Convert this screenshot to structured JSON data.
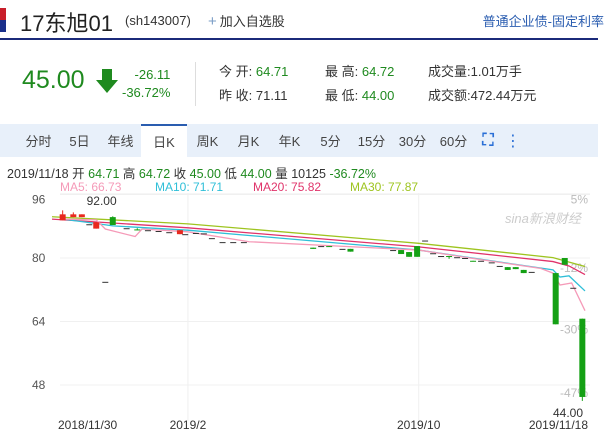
{
  "header": {
    "name": "17东旭01",
    "code": "(sh143007)",
    "add_favorite": "加入自选股",
    "bond_type": "普通企业债-固定利率"
  },
  "quote": {
    "price": "45.00",
    "change": "-26.11",
    "change_pct": "-36.72%",
    "direction_icon": "arrow-down-icon",
    "open_label": "今 开:",
    "open": "64.71",
    "prev_close_label": "昨 收:",
    "prev_close": "71.11",
    "high_label": "最 高:",
    "high": "64.72",
    "low_label": "最 低:",
    "low": "44.00",
    "volume_label": "成交量:",
    "volume": "1.01万手",
    "amount_label": "成交额:",
    "amount": "472.44万元"
  },
  "tabs": [
    "分时",
    "5日",
    "年线",
    "日K",
    "周K",
    "月K",
    "年K",
    "5分",
    "15分",
    "30分",
    "60分"
  ],
  "active_tab": "日K",
  "info": {
    "date": "2019/11/18",
    "open_l": "开",
    "open": "64.71",
    "high_l": "高",
    "high": "64.72",
    "close_l": "收",
    "close": "45.00",
    "low_l": "低",
    "low": "44.00",
    "vol_l": "量",
    "vol": "10125",
    "pct": "-36.72%"
  },
  "ma_legend": {
    "ma5": "MA5: 66.73",
    "ma10": "MA10: 71.71",
    "ma20": "MA20: 75.82",
    "ma30": "MA30: 77.87"
  },
  "colors": {
    "up": "#e8281e",
    "down": "#14a014",
    "ma5": "#f59ab8",
    "ma10": "#2fbfd8",
    "ma20": "#e0336a",
    "ma30": "#9ec41f",
    "accent": "#2a5db0"
  },
  "chart_data": {
    "type": "candlestick",
    "watermark": "sina新浪财经",
    "x_range": [
      0,
      100
    ],
    "ylim": [
      42,
      98
    ],
    "y_ticks": [
      96,
      80,
      64,
      48
    ],
    "right_ticks": [
      {
        "label": "5%",
        "value": 96
      },
      {
        "label": "-12%",
        "value": 77.5
      },
      {
        "label": "-30%",
        "value": 62
      },
      {
        "label": "-47%",
        "value": 46
      }
    ],
    "x_ticks": [
      {
        "label": "2018/11/30",
        "x": 2
      },
      {
        "label": "2019/2",
        "x": 25.5
      },
      {
        "label": "2019/10",
        "x": 68.8
      },
      {
        "label": "2019/11/18",
        "x": 99.5
      }
    ],
    "max_label": {
      "text": "92.00",
      "x": 8,
      "value": 92
    },
    "min_label": {
      "text": "44.00",
      "x": 99.5,
      "value": 44
    },
    "candles": [
      {
        "x": 2,
        "o": 89.5,
        "c": 91,
        "h": 92,
        "l": 89.5
      },
      {
        "x": 4,
        "o": 90.3,
        "c": 91,
        "h": 91.5,
        "l": 90.3
      },
      {
        "x": 5.6,
        "o": 90.3,
        "c": 91,
        "h": 91,
        "l": 90.3
      },
      {
        "x": 7,
        "o": 88.5,
        "c": 88.5,
        "h": 88.5,
        "l": 88.5
      },
      {
        "x": 8.3,
        "o": 87.4,
        "c": 89,
        "h": 89,
        "l": 87.4
      },
      {
        "x": 10,
        "o": 74,
        "c": 74,
        "h": 74,
        "l": 74
      },
      {
        "x": 11.4,
        "o": 90.3,
        "c": 88.3,
        "h": 90.5,
        "l": 88.3
      },
      {
        "x": 14,
        "o": 87.5,
        "c": 87.5,
        "h": 87.5,
        "l": 87.5
      },
      {
        "x": 16,
        "o": 87.2,
        "c": 87.1,
        "h": 87.5,
        "l": 87
      },
      {
        "x": 18,
        "o": 87,
        "c": 87,
        "h": 87,
        "l": 87
      },
      {
        "x": 20,
        "o": 86.8,
        "c": 86.8,
        "h": 86.8,
        "l": 86.8
      },
      {
        "x": 22,
        "o": 86.5,
        "c": 86.5,
        "h": 86.5,
        "l": 86.5
      },
      {
        "x": 24,
        "o": 86,
        "c": 87,
        "h": 87,
        "l": 86
      },
      {
        "x": 25,
        "o": 86,
        "c": 86,
        "h": 86,
        "l": 86
      },
      {
        "x": 27,
        "o": 86.3,
        "c": 86.3,
        "h": 86.3,
        "l": 86.3
      },
      {
        "x": 28.5,
        "o": 86.2,
        "c": 86.2,
        "h": 86.2,
        "l": 86.2
      },
      {
        "x": 30,
        "o": 85,
        "c": 85,
        "h": 85,
        "l": 85
      },
      {
        "x": 32,
        "o": 84,
        "c": 84,
        "h": 84,
        "l": 84
      },
      {
        "x": 34,
        "o": 84,
        "c": 84,
        "h": 84,
        "l": 84
      },
      {
        "x": 36,
        "o": 84,
        "c": 84,
        "h": 84,
        "l": 84
      },
      {
        "x": 49,
        "o": 82.6,
        "c": 82.3,
        "h": 82.6,
        "l": 82.3
      },
      {
        "x": 50.5,
        "o": 83,
        "c": 83,
        "h": 83,
        "l": 83
      },
      {
        "x": 52,
        "o": 83,
        "c": 82.8,
        "h": 83,
        "l": 82.8
      },
      {
        "x": 54.5,
        "o": 82.3,
        "c": 82.3,
        "h": 82.3,
        "l": 82.3
      },
      {
        "x": 56,
        "o": 82.3,
        "c": 81.6,
        "h": 82.3,
        "l": 81.6
      },
      {
        "x": 64,
        "o": 82,
        "c": 82,
        "h": 82,
        "l": 82
      },
      {
        "x": 65.5,
        "o": 82,
        "c": 81,
        "h": 82,
        "l": 81
      },
      {
        "x": 67,
        "o": 81.5,
        "c": 80.3,
        "h": 81.5,
        "l": 80.3
      },
      {
        "x": 68.5,
        "o": 83,
        "c": 80.3,
        "h": 83,
        "l": 80.3
      },
      {
        "x": 70,
        "o": 84.4,
        "c": 84.4,
        "h": 84.4,
        "l": 84.4
      },
      {
        "x": 71.5,
        "o": 81.2,
        "c": 81.2,
        "h": 81.2,
        "l": 81.2
      },
      {
        "x": 73,
        "o": 80.5,
        "c": 80.5,
        "h": 80.5,
        "l": 80.5
      },
      {
        "x": 74.5,
        "o": 80.5,
        "c": 80.3,
        "h": 80.5,
        "l": 79.8
      },
      {
        "x": 76,
        "o": 80.2,
        "c": 80.2,
        "h": 80.2,
        "l": 80.2
      },
      {
        "x": 77.5,
        "o": 80,
        "c": 80,
        "h": 80,
        "l": 80
      },
      {
        "x": 79,
        "o": 79.3,
        "c": 79.1,
        "h": 79.3,
        "l": 79.1
      },
      {
        "x": 80.5,
        "o": 79.3,
        "c": 79.3,
        "h": 79.3,
        "l": 79.3
      },
      {
        "x": 82.5,
        "o": 78.9,
        "c": 78.9,
        "h": 78.9,
        "l": 78.9
      },
      {
        "x": 84,
        "o": 78,
        "c": 78,
        "h": 78,
        "l": 78
      },
      {
        "x": 85.5,
        "o": 77.7,
        "c": 77,
        "h": 77.7,
        "l": 77
      },
      {
        "x": 87,
        "o": 77.7,
        "c": 77.2,
        "h": 77.7,
        "l": 77.2
      },
      {
        "x": 88.5,
        "o": 77,
        "c": 76.2,
        "h": 77,
        "l": 76.2
      },
      {
        "x": 90,
        "o": 76.5,
        "c": 76.5,
        "h": 76.5,
        "l": 76.5
      },
      {
        "x": 94.5,
        "o": 76.2,
        "c": 63.3,
        "h": 76.2,
        "l": 63.3
      },
      {
        "x": 96.2,
        "o": 80,
        "c": 78.3,
        "h": 80,
        "l": 78.3
      },
      {
        "x": 97.8,
        "o": 72.5,
        "c": 72.5,
        "h": 72.5,
        "l": 72.5
      },
      {
        "x": 99.5,
        "o": 64.71,
        "c": 45,
        "h": 64.72,
        "l": 44
      }
    ],
    "series": [
      {
        "name": "MA30",
        "x": [
          0,
          25.5,
          68.8,
          94,
          100
        ],
        "values": [
          90.4,
          88.6,
          83.7,
          80.1,
          77.87
        ]
      },
      {
        "name": "MA20",
        "x": [
          0,
          25.5,
          68.8,
          94,
          97,
          100
        ],
        "values": [
          89.8,
          87.6,
          82.8,
          79.1,
          78,
          75.82
        ]
      },
      {
        "name": "MA10",
        "x": [
          2,
          8.3,
          11.4,
          25.5,
          68.8,
          94,
          95.3,
          97,
          100
        ],
        "values": [
          89.8,
          88.7,
          88.1,
          87,
          82,
          77,
          75.2,
          75.5,
          71.71
        ]
      },
      {
        "name": "MA5",
        "x": [
          2,
          8.3,
          10,
          15.6,
          16.9,
          25.5,
          37,
          68.8,
          78.4,
          91.6,
          94,
          95.3,
          97.5,
          100
        ],
        "values": [
          89.8,
          89.6,
          87.3,
          85.4,
          87.3,
          86.6,
          84.1,
          82,
          80,
          77.4,
          76.2,
          73.2,
          73.7,
          66.73
        ]
      }
    ]
  }
}
